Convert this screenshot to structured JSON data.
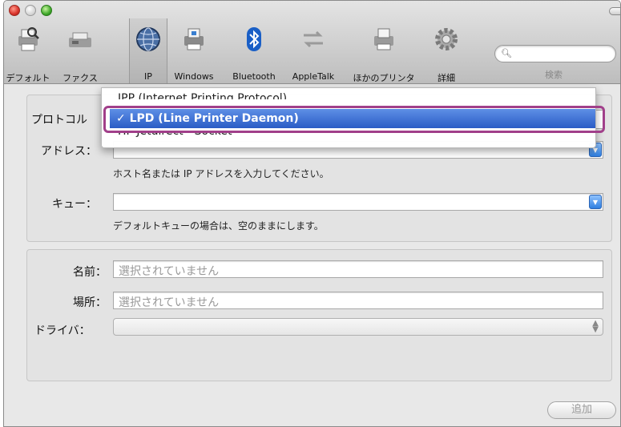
{
  "toolbar": {
    "buttons": [
      {
        "label": "デフォルト",
        "icon": "printer-magnifier-icon"
      },
      {
        "label": "ファクス",
        "icon": "fax-icon"
      },
      {
        "label": "IP",
        "icon": "globe-icon"
      },
      {
        "label": "Windows",
        "icon": "windows-printer-icon"
      },
      {
        "label": "Bluetooth",
        "icon": "bluetooth-icon"
      },
      {
        "label": "AppleTalk",
        "icon": "appletalk-arrows-icon"
      },
      {
        "label": "ほかのプリンタ",
        "icon": "printer-icon"
      },
      {
        "label": "詳細",
        "icon": "gear-icon"
      }
    ],
    "search_label": "検索"
  },
  "form": {
    "protocol_label": "プロトコル",
    "address_label": "アドレス：",
    "address_hint": "ホスト名または IP アドレスを入力してください。",
    "queue_label": "キュー：",
    "queue_hint": "デフォルトキューの場合は、空のままにします。"
  },
  "protocol_menu": {
    "items": [
      {
        "label": "IPP (Internet Printing Protocol)"
      },
      {
        "label": "✓ LPD (Line Printer Daemon)"
      },
      {
        "label": "HP Jetdirect - Socket"
      }
    ]
  },
  "info": {
    "name_label": "名前：",
    "name_value": "選択されていません",
    "location_label": "場所：",
    "location_value": "選択されていません",
    "driver_label": "ドライバ："
  },
  "add_button": "追加",
  "colors": {
    "selection": "#2a5cc5",
    "highlight_frame": "#a13f8a"
  }
}
